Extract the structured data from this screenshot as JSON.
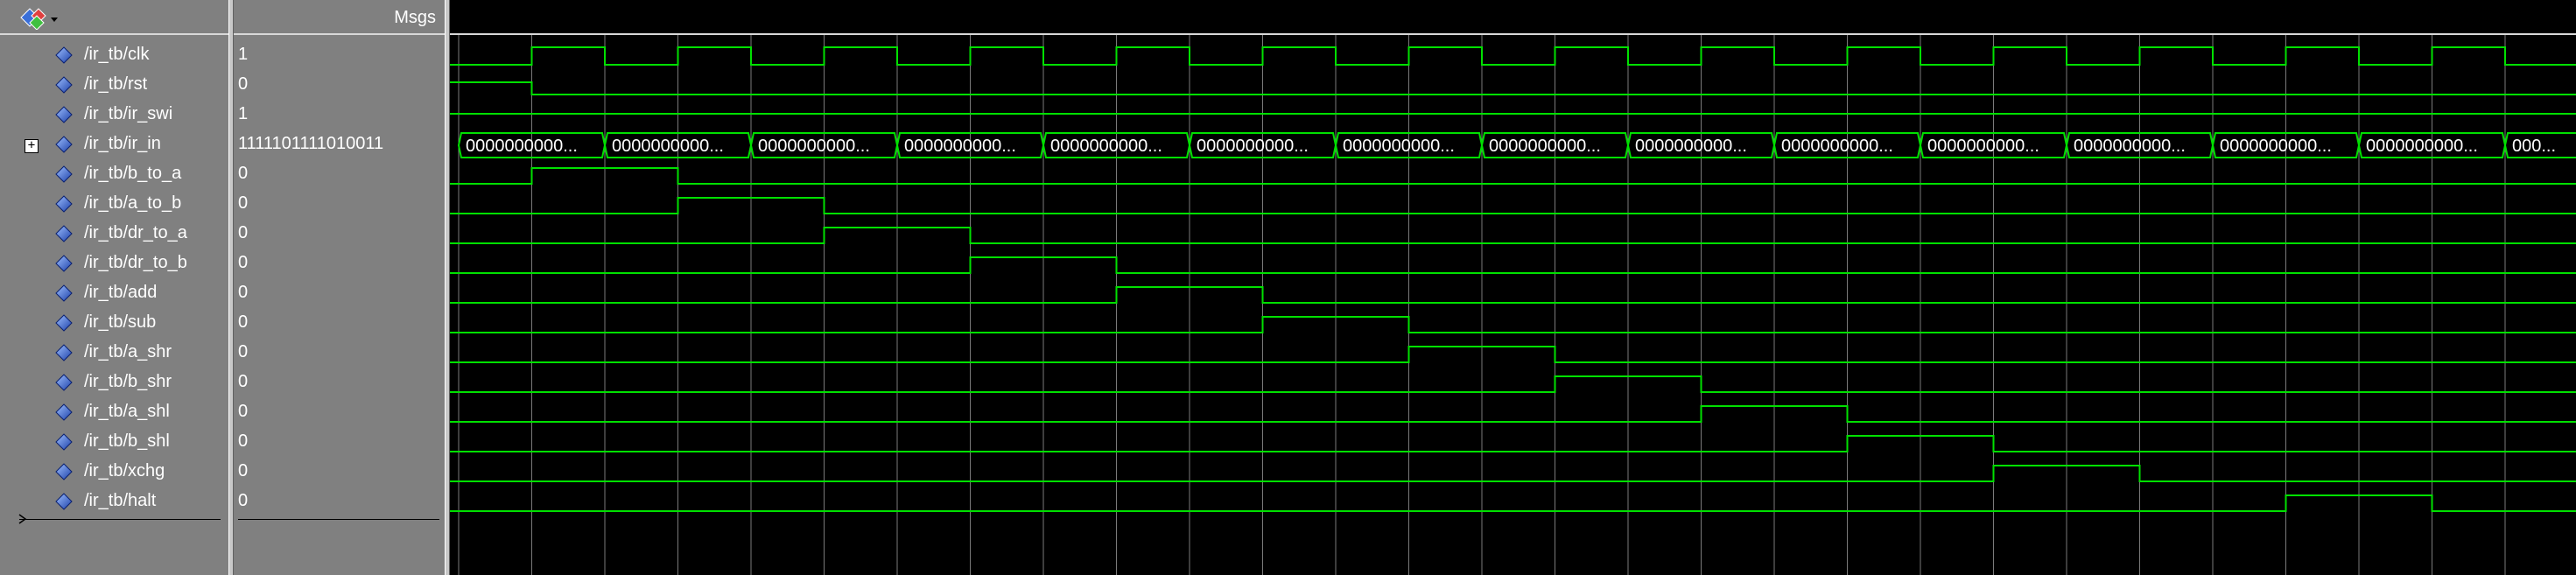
{
  "header": {
    "msgs_label": "Msgs"
  },
  "signals": [
    {
      "name": "/ir_tb/clk",
      "value": "1",
      "expandable": false
    },
    {
      "name": "/ir_tb/rst",
      "value": "0",
      "expandable": false
    },
    {
      "name": "/ir_tb/ir_swi",
      "value": "1",
      "expandable": false
    },
    {
      "name": "/ir_tb/ir_in",
      "value": "1111101111010011",
      "expandable": true
    },
    {
      "name": "/ir_tb/b_to_a",
      "value": "0",
      "expandable": false
    },
    {
      "name": "/ir_tb/a_to_b",
      "value": "0",
      "expandable": false
    },
    {
      "name": "/ir_tb/dr_to_a",
      "value": "0",
      "expandable": false
    },
    {
      "name": "/ir_tb/dr_to_b",
      "value": "0",
      "expandable": false
    },
    {
      "name": "/ir_tb/add",
      "value": "0",
      "expandable": false
    },
    {
      "name": "/ir_tb/sub",
      "value": "0",
      "expandable": false
    },
    {
      "name": "/ir_tb/a_shr",
      "value": "0",
      "expandable": false
    },
    {
      "name": "/ir_tb/b_shr",
      "value": "0",
      "expandable": false
    },
    {
      "name": "/ir_tb/a_shl",
      "value": "0",
      "expandable": false
    },
    {
      "name": "/ir_tb/b_shl",
      "value": "0",
      "expandable": false
    },
    {
      "name": "/ir_tb/xchg",
      "value": "0",
      "expandable": false
    },
    {
      "name": "/ir_tb/halt",
      "value": "0",
      "expandable": false
    }
  ],
  "bus_labels": [
    "0000000000...",
    "0000000000...",
    "0000000000...",
    "0000000000...",
    "0000000000...",
    "0000000000...",
    "0000000000...",
    "0000000000...",
    "0000000000...",
    "0000000000...",
    "0000000000...",
    "0000000000...",
    "0000000000...",
    "0000000000...",
    "000..."
  ],
  "colors": {
    "wave": "#00e000",
    "grid": "#7a7a7a",
    "pane": "#808080",
    "icon": "#3a6fd8"
  },
  "icons": {
    "signal": "blue-diamond-icon",
    "toolbar": "wave-toolbar-icon"
  }
}
